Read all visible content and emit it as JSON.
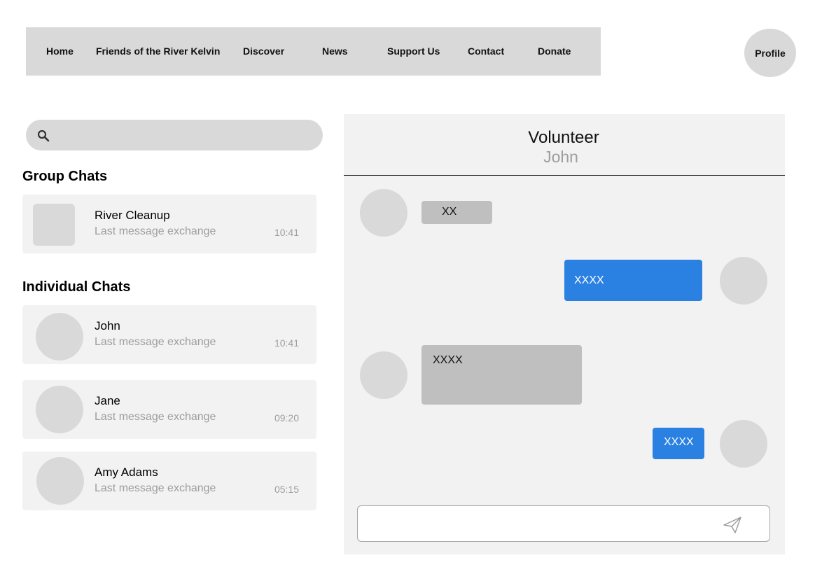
{
  "nav": {
    "items": [
      "Home",
      "Friends of the River Kelvin",
      "Discover",
      "News",
      "Support Us",
      "Contact",
      "Donate"
    ],
    "profile_label": "Profile"
  },
  "search": {
    "placeholder": "",
    "value": "",
    "icon": "search-icon"
  },
  "sidebar": {
    "group_title": "Group Chats",
    "groups": [
      {
        "name": "River Cleanup",
        "preview": "Last message exchange",
        "time": "10:41"
      }
    ],
    "individual_title": "Individual Chats",
    "individuals": [
      {
        "name": "John",
        "preview": "Last message exchange",
        "time": "10:41"
      },
      {
        "name": "Jane",
        "preview": "Last message exchange",
        "time": "09:20"
      },
      {
        "name": "Amy Adams",
        "preview": "Last message exchange",
        "time": "05:15"
      }
    ]
  },
  "conversation": {
    "title": "Volunteer",
    "subtitle": "John",
    "messages": [
      {
        "direction": "in",
        "text": "XX"
      },
      {
        "direction": "out",
        "text": "XXXX"
      },
      {
        "direction": "in",
        "text": "XXXX"
      },
      {
        "direction": "out",
        "text": "XXXX"
      }
    ],
    "composer": {
      "placeholder": "",
      "value": "",
      "send_icon": "send-icon"
    }
  },
  "colors": {
    "outgoing_bubble": "#2a81e2",
    "incoming_bubble": "#bfbfbf",
    "panel": "#f2f2f2",
    "placeholder_gray": "#d9d9d9"
  }
}
